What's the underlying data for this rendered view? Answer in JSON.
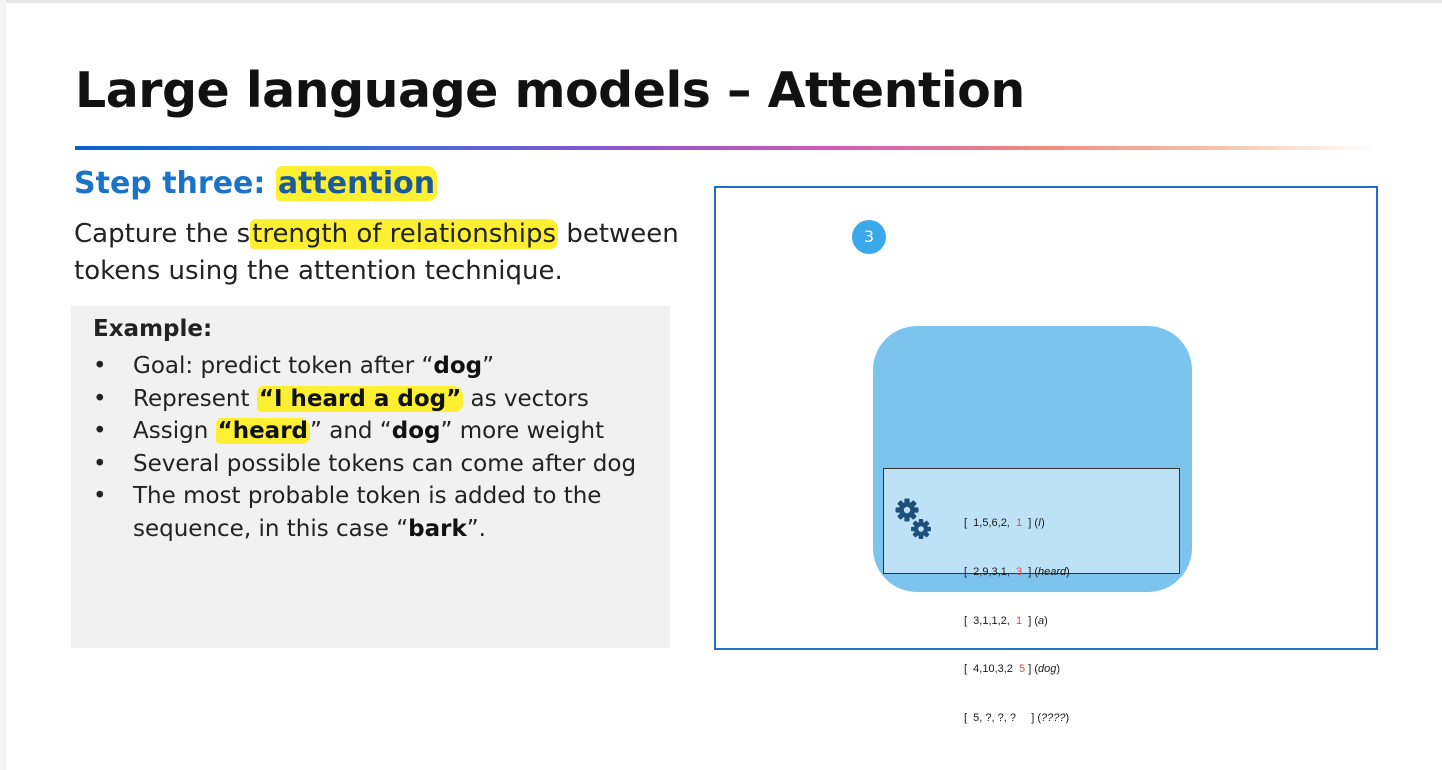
{
  "slide": {
    "title": "Large language models – Attention",
    "step_label_prefix": "Step three: ",
    "step_label_highlight": "attention",
    "description_part1": "Capture the s",
    "description_highlight": "trength of relationships",
    "description_part2": " between tokens using the attention technique.",
    "example": {
      "title": "Example:",
      "bullet_char": "•",
      "bullets": {
        "b1": {
          "t1": "Goal: predict token after “",
          "bold": "dog",
          "t2": "”"
        },
        "b2": {
          "t1": "Represent ",
          "highlight": "“I heard a dog”",
          "t2": " as vectors"
        },
        "b3": {
          "t1": "Assign ",
          "highlight": "“heard",
          "t2": "” and “",
          "bold": "dog",
          "t3": "” more weight"
        },
        "b4": {
          "t1": "Several possible tokens can come after dog"
        },
        "b5": {
          "t1": "The most probable token is added to the sequence, in this case “",
          "bold": "bark",
          "t2": "”."
        }
      }
    }
  },
  "diagram": {
    "step_number": "3",
    "vectors": [
      {
        "open": "[  1,5,6,2,  ",
        "weight": "1",
        "close": "  ] (",
        "word": "I",
        "end": ")"
      },
      {
        "open": "[  2,9,3,1,  ",
        "weight": "3",
        "close": "  ] (",
        "word": "heard",
        "end": ")"
      },
      {
        "open": "[  3,1,1,2,  ",
        "weight": "1",
        "close": "  ] (",
        "word": "a",
        "end": ")"
      },
      {
        "open": "[  4,10,3,2  ",
        "weight": "5",
        "close": " ] (",
        "word": "dog",
        "end": ")"
      },
      {
        "open": "[  5, ?, ?, ?     ",
        "weight": "",
        "close": "] (",
        "word": "????",
        "end": ")"
      }
    ],
    "colors": {
      "card": "#7cc4ee",
      "matrix_bg": "#bde2f8",
      "weight_highlight": "#e04848",
      "gear": "#1d4f7a",
      "badge": "#3aa9ec"
    }
  }
}
